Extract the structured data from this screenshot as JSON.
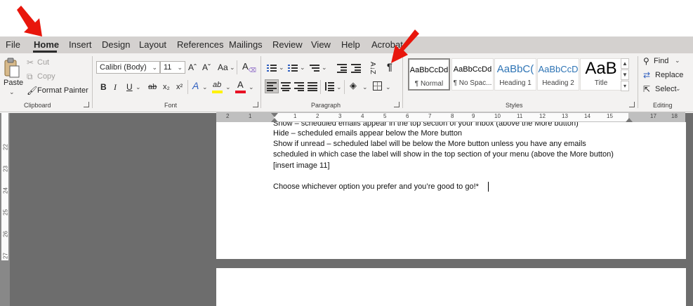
{
  "tabs": [
    "File",
    "Home",
    "Insert",
    "Design",
    "Layout",
    "References",
    "Mailings",
    "Review",
    "View",
    "Help",
    "Acrobat"
  ],
  "active_tab": "Home",
  "clipboard": {
    "paste": "Paste",
    "cut": "Cut",
    "copy": "Copy",
    "format_painter": "Format Painter",
    "label": "Clipboard"
  },
  "font": {
    "name": "Calibri (Body)",
    "size": "11",
    "grow": "Aˆ",
    "shrink": "Aˇ",
    "case": "Aa",
    "bold": "B",
    "italic": "I",
    "underline": "U",
    "strike": "ab",
    "subscript": "x₂",
    "superscript": "x²",
    "effects": "A",
    "highlight": "ab",
    "color": "A",
    "label": "Font"
  },
  "paragraph": {
    "sort": "A↓Z",
    "show_marks": "¶",
    "label": "Paragraph"
  },
  "styles": {
    "tiles": [
      {
        "preview": "AaBbCcDd",
        "name": "¶ Normal"
      },
      {
        "preview": "AaBbCcDd",
        "name": "¶ No Spac..."
      },
      {
        "preview": "AaBbC(",
        "name": "Heading 1"
      },
      {
        "preview": "AaBbCcD",
        "name": "Heading 2"
      },
      {
        "preview": "AaB",
        "name": "Title"
      }
    ],
    "label": "Styles"
  },
  "editing": {
    "find": "Find",
    "replace": "Replace",
    "select": "Select",
    "label": "Editing"
  },
  "ruler": {
    "h_marks": [
      "2",
      "1",
      "1",
      "2",
      "3",
      "4",
      "5",
      "6",
      "7",
      "8",
      "9",
      "10",
      "11",
      "12",
      "13",
      "14",
      "15",
      "17",
      "18"
    ],
    "v_marks": [
      "22",
      "23",
      "24",
      "25",
      "26",
      "27"
    ]
  },
  "document": {
    "lines": [
      "Show – scheduled emails appear in the top section of your inbox (above the More button)",
      "Hide – scheduled emails appear below the More button",
      "Show if unread – scheduled label will be below the More button unless you have any emails",
      "scheduled in which case the label will show in the top section of your menu (above the More button)",
      "[insert image 11]",
      "",
      "Choose whichever option you prefer and you’re good to go!*"
    ]
  },
  "colors": {
    "annotation_arrow": "#e8160c",
    "ribbon": "#f3f2f1",
    "tabbar": "#d4d1cf",
    "workspace": "#6d6d6d",
    "font_color_bar": "#e81123",
    "highlight_bar": "#fff200"
  },
  "icons": [
    "paste-icon",
    "cut-icon",
    "copy-icon",
    "format-painter-icon",
    "font-effects-icon",
    "highlight-icon",
    "font-color-icon",
    "bullets-icon",
    "numbering-icon",
    "multilevel-icon",
    "decrease-indent-icon",
    "increase-indent-icon",
    "sort-icon",
    "pilcrow-icon",
    "align-left-icon",
    "center-icon",
    "align-right-icon",
    "justify-icon",
    "line-spacing-icon",
    "shading-icon",
    "borders-icon",
    "find-icon",
    "replace-icon",
    "select-icon",
    "red-arrow-icon"
  ]
}
